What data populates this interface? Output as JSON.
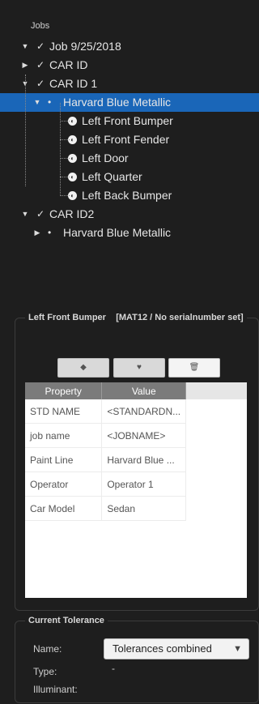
{
  "panel": {
    "title": "Jobs"
  },
  "tree": {
    "job": {
      "label": "Job 9/25/2018"
    },
    "car_id": {
      "label": "CAR ID"
    },
    "car_id_1": {
      "label": "CAR ID 1"
    },
    "color_1": {
      "label": "Harvard Blue Metallic"
    },
    "panels": [
      {
        "label": "Left Front Bumper"
      },
      {
        "label": "Left Front Fender"
      },
      {
        "label": "Left Door"
      },
      {
        "label": "Left Quarter"
      },
      {
        "label": "Left Back Bumper"
      }
    ],
    "car_id_2": {
      "label": "CAR ID2"
    },
    "color_2": {
      "label": "Harvard Blue Metallic"
    }
  },
  "details": {
    "title": "Left Front Bumper",
    "subtitle": "[MAT12 / No serialnumber set]",
    "toolbar": [
      "pick-icon",
      "paint-icon",
      "trash-icon"
    ],
    "columns": {
      "property": "Property",
      "value": "Value"
    },
    "rows": [
      {
        "property": "STD NAME",
        "value": "<STANDARDN..."
      },
      {
        "property": "job name",
        "value": "<JOBNAME>"
      },
      {
        "property": "Paint Line",
        "value": "Harvard Blue ..."
      },
      {
        "property": "Operator",
        "value": "Operator 1"
      },
      {
        "property": "Car Model",
        "value": "Sedan"
      }
    ]
  },
  "tolerance": {
    "title": "Current Tolerance",
    "name_label": "Name:",
    "name_value": "Tolerances combined",
    "type_label": "Type:",
    "type_value": "-",
    "illuminant_label": "Illuminant:"
  },
  "colors": {
    "selection": "#1a66b8",
    "background": "#1e1e1e"
  }
}
